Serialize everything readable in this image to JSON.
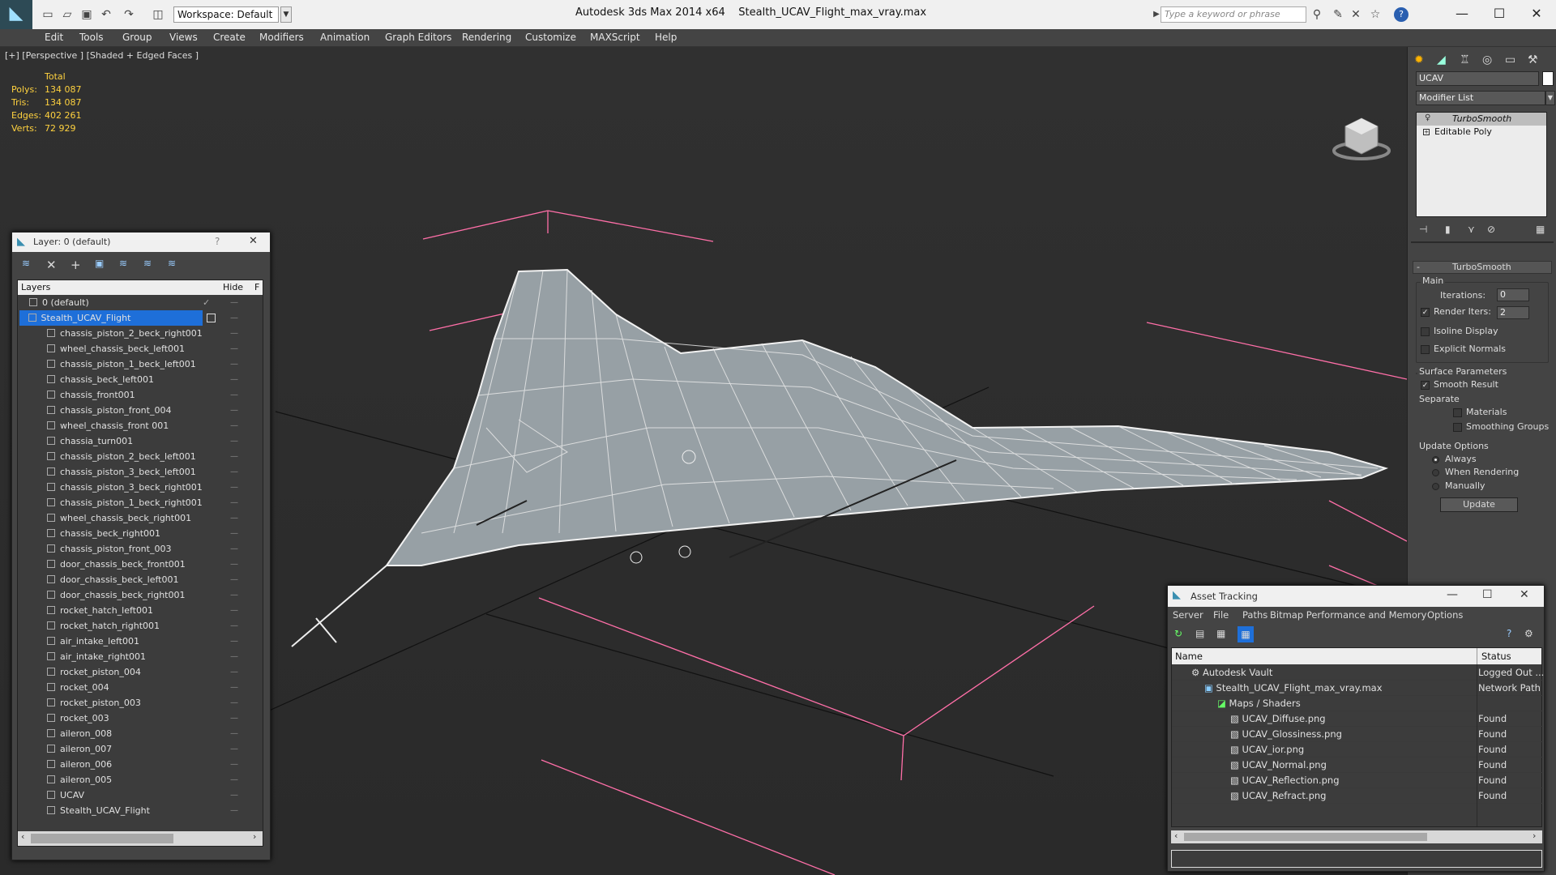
{
  "titlebar": {
    "workspace": "Workspace: Default",
    "app": "Autodesk 3ds Max  2014 x64",
    "file": "Stealth_UCAV_Flight_max_vray.max",
    "search_placeholder": "Type a keyword or phrase"
  },
  "menu": [
    "Edit",
    "Tools",
    "Group",
    "Views",
    "Create",
    "Modifiers",
    "Animation",
    "Graph Editors",
    "Rendering",
    "Customize",
    "MAXScript",
    "Help"
  ],
  "viewport": {
    "label": "[+] [Perspective ] [Shaded + Edged Faces ]",
    "stats": {
      "header": "Total",
      "rows": [
        {
          "k": "Polys:",
          "v": "134 087"
        },
        {
          "k": "Tris:",
          "v": "134 087"
        },
        {
          "k": "Edges:",
          "v": "402 261"
        },
        {
          "k": "Verts:",
          "v": "72 929"
        }
      ]
    }
  },
  "cmd": {
    "object_name": "UCAV",
    "modifier_list": "Modifier List",
    "stack": [
      "TurboSmooth",
      "Editable Poly"
    ],
    "rollout": "TurboSmooth",
    "main": "Main",
    "iterations_label": "Iterations:",
    "iterations": "0",
    "render_iters_label": "Render Iters:",
    "render_iters": "2",
    "isoline": "Isoline Display",
    "explicit": "Explicit Normals",
    "surface": "Surface Parameters",
    "smooth": "Smooth Result",
    "separate": "Separate",
    "materials": "Materials",
    "smoothing": "Smoothing Groups",
    "update_opts": "Update Options",
    "always": "Always",
    "when_rendering": "When Rendering",
    "manually": "Manually",
    "update": "Update"
  },
  "layers": {
    "title": "Layer: 0 (default)",
    "col_layers": "Layers",
    "col_hide": "Hide",
    "col_f": "F",
    "items": [
      "0 (default)",
      "Stealth_UCAV_Flight",
      "chassis_piston_2_beck_right001",
      "wheel_chassis_beck_left001",
      "chassis_piston_1_beck_left001",
      "chassis_beck_left001",
      "chassis_front001",
      "chassis_piston_front_004",
      "wheel_chassis_front 001",
      "chassia_turn001",
      "chassis_piston_2_beck_left001",
      "chassis_piston_3_beck_left001",
      "chassis_piston_3_beck_right001",
      "chassis_piston_1_beck_right001",
      "wheel_chassis_beck_right001",
      "chassis_beck_right001",
      "chassis_piston_front_003",
      "door_chassis_beck_front001",
      "door_chassis_beck_left001",
      "door_chassis_beck_right001",
      "rocket_hatch_left001",
      "rocket_hatch_right001",
      "air_intake_left001",
      "air_intake_right001",
      "rocket_piston_004",
      "rocket_004",
      "rocket_piston_003",
      "rocket_003",
      "aileron_008",
      "aileron_007",
      "aileron_006",
      "aileron_005",
      "UCAV",
      "Stealth_UCAV_Flight"
    ]
  },
  "asset": {
    "title": "Asset Tracking",
    "menu": [
      "Server",
      "File",
      "Paths",
      "Bitmap Performance and Memory",
      "Options"
    ],
    "col_name": "Name",
    "col_status": "Status",
    "rows": [
      {
        "name": "Autodesk Vault",
        "status": "Logged Out ..."
      },
      {
        "name": "Stealth_UCAV_Flight_max_vray.max",
        "status": "Network Path"
      },
      {
        "name": "Maps / Shaders",
        "status": ""
      },
      {
        "name": "UCAV_Diffuse.png",
        "status": "Found"
      },
      {
        "name": "UCAV_Glossiness.png",
        "status": "Found"
      },
      {
        "name": "UCAV_ior.png",
        "status": "Found"
      },
      {
        "name": "UCAV_Normal.png",
        "status": "Found"
      },
      {
        "name": "UCAV_Reflection.png",
        "status": "Found"
      },
      {
        "name": "UCAV_Refract.png",
        "status": "Found"
      }
    ]
  },
  "colors": {
    "accent": "#1e6fd9",
    "stats": "#ffd23f",
    "grid_pink": "#ff6fa8",
    "viewport": "#2d2d2d"
  }
}
